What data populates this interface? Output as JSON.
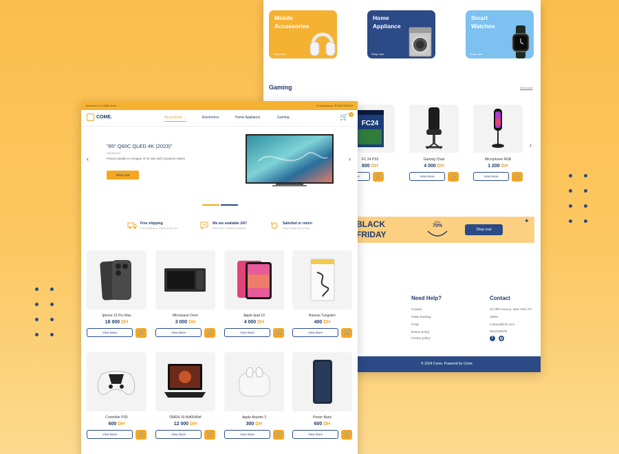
{
  "back": {
    "categories": [
      {
        "title": "Mobile\nAccessories",
        "cta": "Shop now",
        "bg": "#f5b132",
        "fg": "#ffffff"
      },
      {
        "title": "Home\nAppliance",
        "cta": "Shop now",
        "bg": "#2b4a86",
        "fg": "#ffffff"
      },
      {
        "title": "Smart\nWatches",
        "cta": "Shop now",
        "bg": "#7cc1f0",
        "fg": "#ffffff"
      }
    ],
    "gaming": {
      "title": "Gaming",
      "view_more": "View more",
      "items": [
        {
          "name": "FC 24 PS5",
          "amount": "600",
          "currency": "DH",
          "view": "View More"
        },
        {
          "name": "Gaming Chair",
          "amount": "4 000",
          "currency": "DH",
          "view": "View More"
        },
        {
          "name": "Microphone RGB",
          "amount": "1 200",
          "currency": "DH",
          "view": "View More"
        }
      ]
    },
    "promo": {
      "line1": "BLACK",
      "line2": "FRIDAY",
      "badge_top": "UPto",
      "badge_value": "70%",
      "cta": "Shop now"
    },
    "footer": {
      "help_title": "Need Help?",
      "help_items": [
        "Contact",
        "Order tracking",
        "FAQs",
        "Return policy",
        "Privacy policy"
      ],
      "contact_title": "Contact",
      "contact_items": [
        "22 Fifth Avenue, New York, NY",
        "10001",
        "contact@info.com",
        "0612345678"
      ],
      "copyright": "© 2024 Come. Powered by Come"
    }
  },
  "front": {
    "topbar": {
      "welcome": "Welcome to COME store",
      "location": "Casablanca",
      "phone": "0612345678"
    },
    "brand": "COME.",
    "nav": [
      "All products",
      "Electronics",
      "Home Appliance",
      "Gaming"
    ],
    "cart_count": "0",
    "hero": {
      "title": "\"85\" Q60C QLED 4K (2023)\"",
      "brand": "SAMSUNG",
      "desc": "Picture quality in a league of its own with Quantum Matrix",
      "cta": "Shop now"
    },
    "features": [
      {
        "title": "Free shipping",
        "sub": "Free shipping on orders in Morocco",
        "icon": "truck-icon"
      },
      {
        "title": "We are available 24/7",
        "sub": "Need help? contact us anytime",
        "icon": "chat-icon"
      },
      {
        "title": "Satisfied or return",
        "sub": "Easy 30-day return policy",
        "icon": "return-icon"
      }
    ],
    "products": [
      {
        "name": "Iphone 15 Pro Max",
        "amount": "18 000",
        "currency": "DH",
        "view": "View More",
        "img": "phone"
      },
      {
        "name": "Microwave Oven",
        "amount": "3 000",
        "currency": "DH",
        "view": "View More",
        "img": "microwave"
      },
      {
        "name": "Apple Ipad 10",
        "amount": "4 000",
        "currency": "DH",
        "view": "View More",
        "img": "ipad"
      },
      {
        "name": "Baseus Tungsten",
        "amount": "400",
        "currency": "DH",
        "view": "View More",
        "img": "cable"
      },
      {
        "name": "Controller PS5",
        "amount": "600",
        "currency": "DH",
        "view": "View More",
        "img": "controller"
      },
      {
        "name": "OMEN 16-Wd0040nf",
        "amount": "12 000",
        "currency": "DH",
        "view": "View More",
        "img": "laptop"
      },
      {
        "name": "Apple Airpods 3",
        "amount": "300",
        "currency": "DH",
        "view": "View More",
        "img": "airpods"
      },
      {
        "name": "Power Bank",
        "amount": "600",
        "currency": "DH",
        "view": "View More",
        "img": "powerbank"
      }
    ]
  }
}
